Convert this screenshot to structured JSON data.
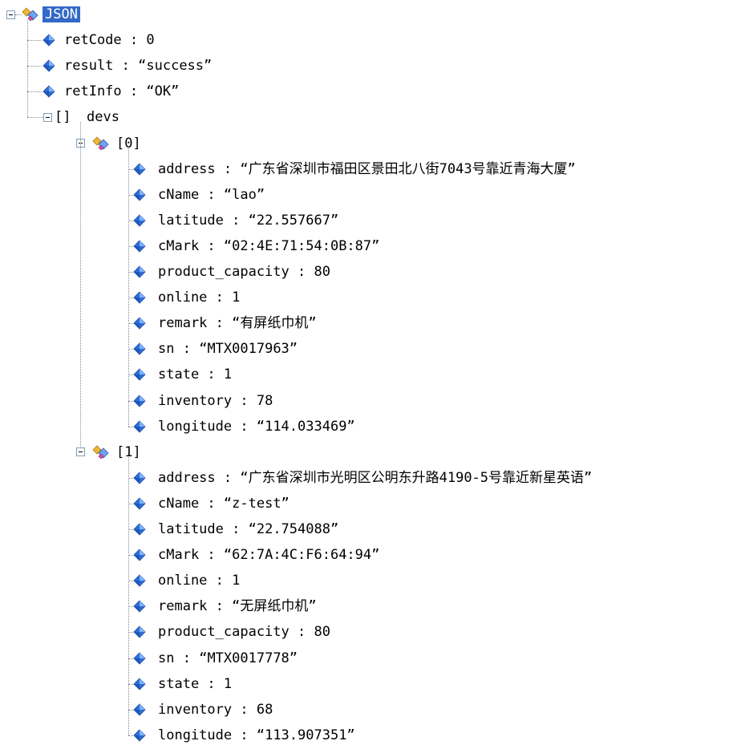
{
  "root": {
    "label": "JSON"
  },
  "nodes": [
    {
      "key": "retCode",
      "sep": " : ",
      "value": "0"
    },
    {
      "key": "result",
      "sep": " : ",
      "value": "“success”"
    },
    {
      "key": "retInfo",
      "sep": " : ",
      "value": "“OK”"
    }
  ],
  "devs": {
    "bracket": "[]",
    "label": "devs",
    "items": [
      {
        "index": "[0]",
        "fields": [
          {
            "key": "address",
            "sep": " : ",
            "value": "“广东省深圳市福田区景田北八街7043号靠近青海大厦”"
          },
          {
            "key": "cName",
            "sep": " : ",
            "value": "“lao”"
          },
          {
            "key": "latitude",
            "sep": " : ",
            "value": "“22.557667”"
          },
          {
            "key": "cMark",
            "sep": " : ",
            "value": "“02:4E:71:54:0B:87”"
          },
          {
            "key": "product_capacity",
            "sep": " : ",
            "value": "80"
          },
          {
            "key": "online",
            "sep": " : ",
            "value": "1"
          },
          {
            "key": "remark",
            "sep": " : ",
            "value": "“有屏纸巾机”"
          },
          {
            "key": "sn",
            "sep": " : ",
            "value": "“MTX0017963”"
          },
          {
            "key": "state",
            "sep": " : ",
            "value": "1"
          },
          {
            "key": "inventory",
            "sep": " : ",
            "value": "78"
          },
          {
            "key": "longitude",
            "sep": " : ",
            "value": "“114.033469”"
          }
        ]
      },
      {
        "index": "[1]",
        "fields": [
          {
            "key": "address",
            "sep": " : ",
            "value": "“广东省深圳市光明区公明东升路4190-5号靠近新星英语”"
          },
          {
            "key": "cName",
            "sep": " : ",
            "value": "“z-test”"
          },
          {
            "key": "latitude",
            "sep": " : ",
            "value": "“22.754088”"
          },
          {
            "key": "cMark",
            "sep": " : ",
            "value": "“62:7A:4C:F6:64:94”"
          },
          {
            "key": "online",
            "sep": " : ",
            "value": "1"
          },
          {
            "key": "remark",
            "sep": " : ",
            "value": "“无屏纸巾机”"
          },
          {
            "key": "product_capacity",
            "sep": " : ",
            "value": "80"
          },
          {
            "key": "sn",
            "sep": " : ",
            "value": "“MTX0017778”"
          },
          {
            "key": "state",
            "sep": " : ",
            "value": "1"
          },
          {
            "key": "inventory",
            "sep": " : ",
            "value": "68"
          },
          {
            "key": "longitude",
            "sep": " : ",
            "value": "“113.907351”"
          }
        ]
      }
    ]
  },
  "icons": {
    "object": "object-node-icon",
    "leaf": "value-node-icon",
    "array": "array-node-icon"
  },
  "colors": {
    "selection": "#3169c6",
    "leaf_icon": "#2f6fd6",
    "object_icon": "#f2b632"
  }
}
